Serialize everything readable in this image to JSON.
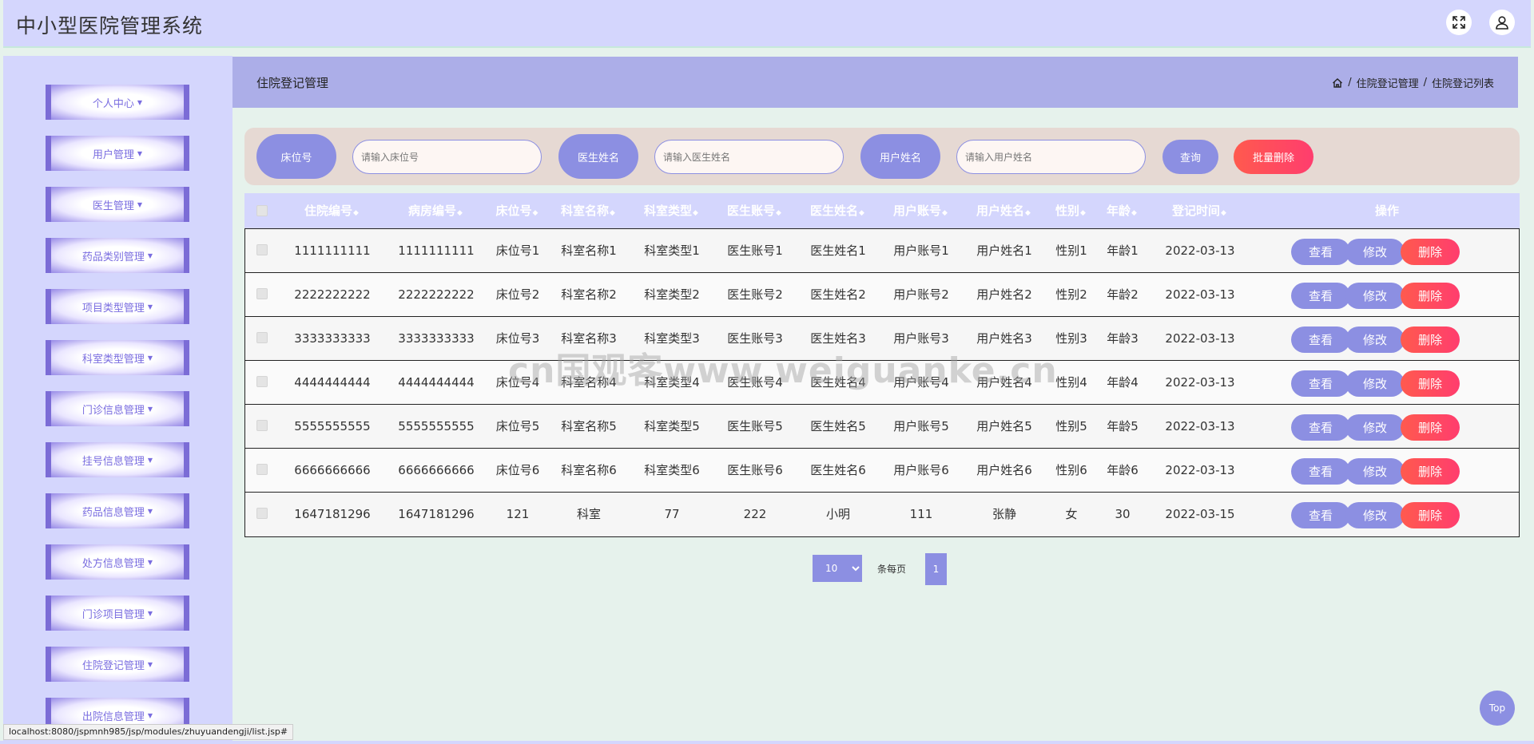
{
  "app": {
    "title": "中小型医院管理系统",
    "fullscreen_icon": "expand-arrows-icon",
    "user_icon": "user-icon"
  },
  "sidebar": {
    "items": [
      {
        "label": "个人中心"
      },
      {
        "label": "用户管理"
      },
      {
        "label": "医生管理"
      },
      {
        "label": "药品类别管理"
      },
      {
        "label": "项目类型管理"
      },
      {
        "label": "科室类型管理"
      },
      {
        "label": "门诊信息管理"
      },
      {
        "label": "挂号信息管理"
      },
      {
        "label": "药品信息管理"
      },
      {
        "label": "处方信息管理"
      },
      {
        "label": "门诊项目管理"
      },
      {
        "label": "住院登记管理"
      },
      {
        "label": "出院信息管理"
      }
    ]
  },
  "page": {
    "title": "住院登记管理",
    "breadcrumb": [
      "住院登记管理",
      "住院登记列表"
    ],
    "breadcrumb_sep": "/"
  },
  "search": {
    "bed_label": "床位号",
    "bed_placeholder": "请输入床位号",
    "doctor_label": "医生姓名",
    "doctor_placeholder": "请输入医生姓名",
    "user_label": "用户姓名",
    "user_placeholder": "请输入用户姓名",
    "query_button": "查询",
    "batch_delete_button": "批量删除"
  },
  "table": {
    "columns": [
      "住院编号",
      "病房编号",
      "床位号",
      "科室名称",
      "科室类型",
      "医生账号",
      "医生姓名",
      "用户账号",
      "用户姓名",
      "性别",
      "年龄",
      "登记时间",
      "操作"
    ],
    "sort_glyph": "◆",
    "rows": [
      [
        "1111111111",
        "1111111111",
        "床位号1",
        "科室名称1",
        "科室类型1",
        "医生账号1",
        "医生姓名1",
        "用户账号1",
        "用户姓名1",
        "性别1",
        "年龄1",
        "2022-03-13"
      ],
      [
        "2222222222",
        "2222222222",
        "床位号2",
        "科室名称2",
        "科室类型2",
        "医生账号2",
        "医生姓名2",
        "用户账号2",
        "用户姓名2",
        "性别2",
        "年龄2",
        "2022-03-13"
      ],
      [
        "3333333333",
        "3333333333",
        "床位号3",
        "科室名称3",
        "科室类型3",
        "医生账号3",
        "医生姓名3",
        "用户账号3",
        "用户姓名3",
        "性别3",
        "年龄3",
        "2022-03-13"
      ],
      [
        "4444444444",
        "4444444444",
        "床位号4",
        "科室名称4",
        "科室类型4",
        "医生账号4",
        "医生姓名4",
        "用户账号4",
        "用户姓名4",
        "性别4",
        "年龄4",
        "2022-03-13"
      ],
      [
        "5555555555",
        "5555555555",
        "床位号5",
        "科室名称5",
        "科室类型5",
        "医生账号5",
        "医生姓名5",
        "用户账号5",
        "用户姓名5",
        "性别5",
        "年龄5",
        "2022-03-13"
      ],
      [
        "6666666666",
        "6666666666",
        "床位号6",
        "科室名称6",
        "科室类型6",
        "医生账号6",
        "医生姓名6",
        "用户账号6",
        "用户姓名6",
        "性别6",
        "年龄6",
        "2022-03-13"
      ],
      [
        "1647181296",
        "1647181296",
        "121",
        "科室",
        "77",
        "222",
        "小明",
        "111",
        "张静",
        "女",
        "30",
        "2022-03-15"
      ]
    ],
    "actions": {
      "view": "查看",
      "edit": "修改",
      "delete": "删除"
    }
  },
  "pagination": {
    "page_size": "10",
    "per_page_label": "条每页",
    "current_page": "1"
  },
  "back_to_top": "Top",
  "watermark": "cn国观客www.weiguanke.cn",
  "status_url": "localhost:8080/jspmnh985/jsp/modules/zhuyuandengji/list.jsp#",
  "colors": {
    "accent": "#8c8fe2",
    "header_bg": "#d4d6fd",
    "danger": "#ff4a5a",
    "page_bg": "#e6f2ec"
  }
}
